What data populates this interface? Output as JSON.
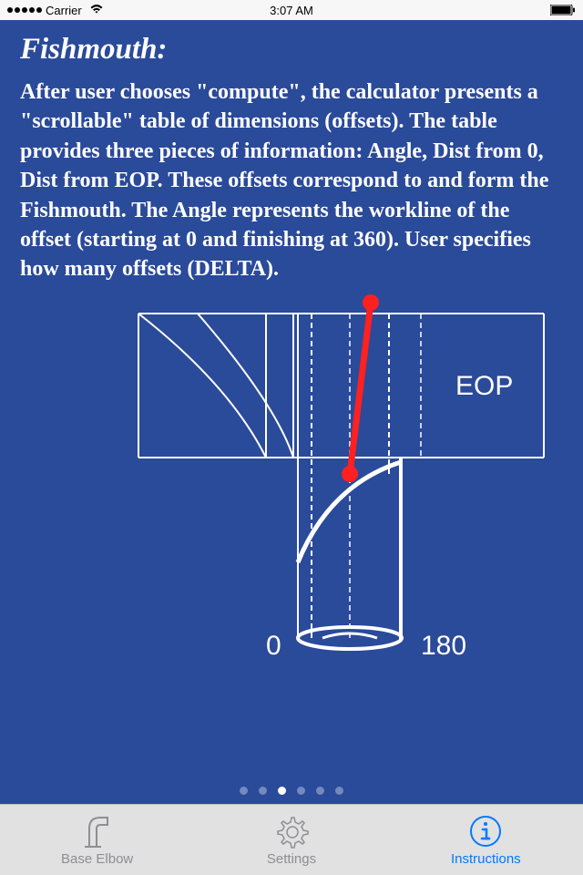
{
  "statusBar": {
    "carrier": "Carrier",
    "time": "3:07 AM"
  },
  "content": {
    "title": "Fishmouth:",
    "description": "After user chooses \"compute\", the calculator presents a \"scrollable\" table of dimensions (offsets). The table provides three pieces of information: Angle, Dist from 0, Dist from EOP. These offsets correspond to and form the Fishmouth. The Angle represents the workline of the offset (starting at 0 and finishing at 360). User specifies how many offsets (DELTA)."
  },
  "diagram": {
    "labelEOP": "EOP",
    "label0": "0",
    "label180": "180"
  },
  "pageIndicator": {
    "total": 6,
    "active": 2
  },
  "tabs": {
    "baseElbow": "Base Elbow",
    "settings": "Settings",
    "instructions": "Instructions",
    "activeIndex": 2
  }
}
